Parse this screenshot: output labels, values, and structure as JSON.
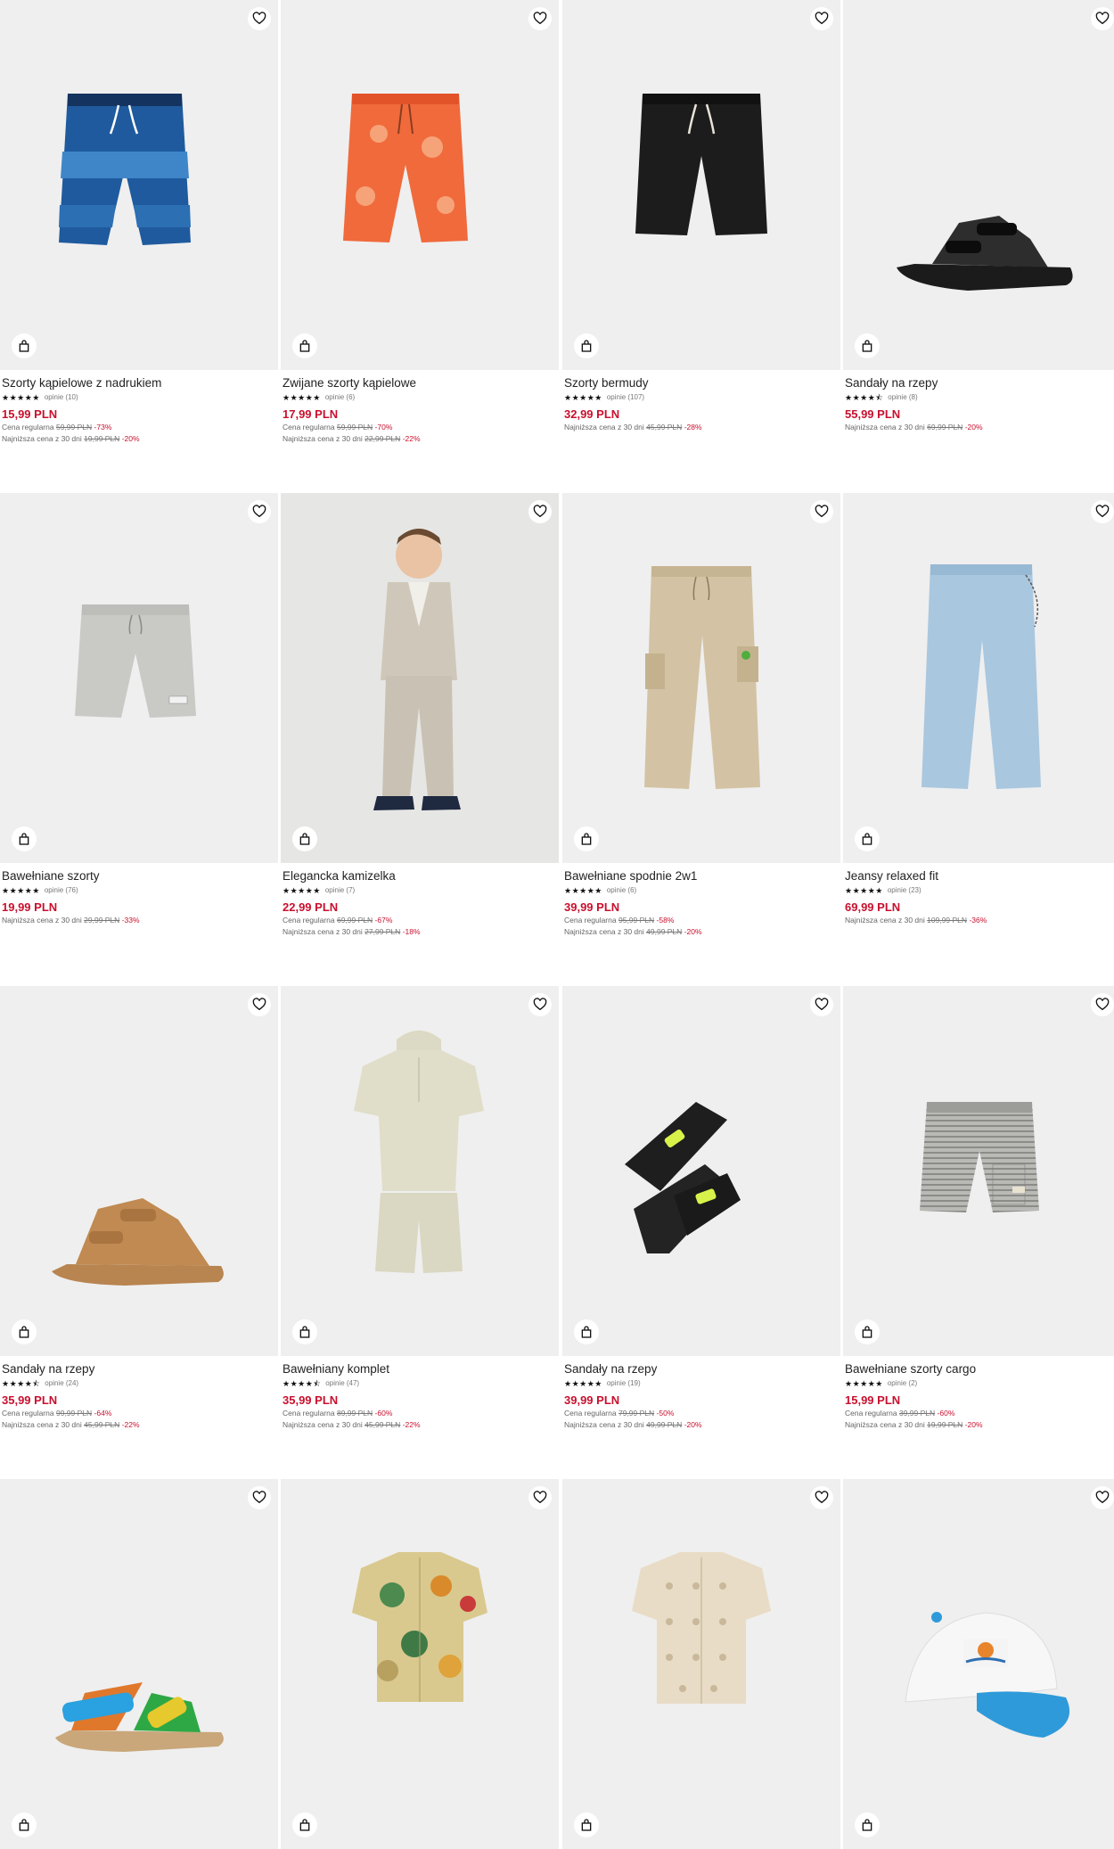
{
  "colors": {
    "sale": "#c8102e",
    "image_bg": "#efefef"
  },
  "icons": {
    "favorite": "heart-outline-icon",
    "cart": "shopping-bag-icon"
  },
  "products": [
    {
      "name": "Szorty kąpielowe z nadrukiem",
      "stars": "★★★★★",
      "reviews": "opinie (10)",
      "price": "15,99 PLN",
      "regular_label": "Cena regularna",
      "regular_old": "59,99 PLN",
      "regular_disc": "-73%",
      "lowest_label": "Najniższa cena z 30 dni",
      "lowest_old": "19,99 PLN",
      "lowest_disc": "-20%"
    },
    {
      "name": "Zwijane szorty kąpielowe",
      "stars": "★★★★★",
      "reviews": "opinie (6)",
      "price": "17,99 PLN",
      "regular_label": "Cena regularna",
      "regular_old": "59,99 PLN",
      "regular_disc": "-70%",
      "lowest_label": "Najniższa cena z 30 dni",
      "lowest_old": "22,99 PLN",
      "lowest_disc": "-22%"
    },
    {
      "name": "Szorty bermudy",
      "stars": "★★★★★",
      "reviews": "opinie (107)",
      "price": "32,99 PLN",
      "lowest_label": "Najniższa cena z 30 dni",
      "lowest_old": "45,99 PLN",
      "lowest_disc": "-28%"
    },
    {
      "name": "Sandały na rzepy",
      "stars": "★★★★⯪",
      "reviews": "opinie (8)",
      "price": "55,99 PLN",
      "lowest_label": "Najniższa cena z 30 dni",
      "lowest_old": "69,99 PLN",
      "lowest_disc": "-20%"
    },
    {
      "name": "Bawełniane szorty",
      "stars": "★★★★★",
      "reviews": "opinie (76)",
      "price": "19,99 PLN",
      "lowest_label": "Najniższa cena z 30 dni",
      "lowest_old": "29,99 PLN",
      "lowest_disc": "-33%"
    },
    {
      "name": "Elegancka kamizelka",
      "stars": "★★★★★",
      "reviews": "opinie (7)",
      "price": "22,99 PLN",
      "regular_label": "Cena regularna",
      "regular_old": "69,99 PLN",
      "regular_disc": "-67%",
      "lowest_label": "Najniższa cena z 30 dni",
      "lowest_old": "27,99 PLN",
      "lowest_disc": "-18%"
    },
    {
      "name": "Bawełniane spodnie 2w1",
      "stars": "★★★★★",
      "reviews": "opinie (6)",
      "price": "39,99 PLN",
      "regular_label": "Cena regularna",
      "regular_old": "95,99 PLN",
      "regular_disc": "-58%",
      "lowest_label": "Najniższa cena z 30 dni",
      "lowest_old": "49,99 PLN",
      "lowest_disc": "-20%"
    },
    {
      "name": "Jeansy relaxed fit",
      "stars": "★★★★★",
      "reviews": "opinie (23)",
      "price": "69,99 PLN",
      "lowest_label": "Najniższa cena z 30 dni",
      "lowest_old": "109,99 PLN",
      "lowest_disc": "-36%"
    },
    {
      "name": "Sandały na rzepy",
      "stars": "★★★★⯪",
      "reviews": "opinie (24)",
      "price": "35,99 PLN",
      "regular_label": "Cena regularna",
      "regular_old": "99,99 PLN",
      "regular_disc": "-64%",
      "lowest_label": "Najniższa cena z 30 dni",
      "lowest_old": "45,99 PLN",
      "lowest_disc": "-22%"
    },
    {
      "name": "Bawełniany komplet",
      "stars": "★★★★⯪",
      "reviews": "opinie (47)",
      "price": "35,99 PLN",
      "regular_label": "Cena regularna",
      "regular_old": "89,99 PLN",
      "regular_disc": "-60%",
      "lowest_label": "Najniższa cena z 30 dni",
      "lowest_old": "45,99 PLN",
      "lowest_disc": "-22%"
    },
    {
      "name": "Sandały na rzepy",
      "stars": "★★★★★",
      "reviews": "opinie (19)",
      "price": "39,99 PLN",
      "regular_label": "Cena regularna",
      "regular_old": "79,99 PLN",
      "regular_disc": "-50%",
      "lowest_label": "Najniższa cena z 30 dni",
      "lowest_old": "49,99 PLN",
      "lowest_disc": "-20%"
    },
    {
      "name": "Bawełniane szorty cargo",
      "stars": "★★★★★",
      "reviews": "opinie (2)",
      "price": "15,99 PLN",
      "regular_label": "Cena regularna",
      "regular_old": "39,99 PLN",
      "regular_disc": "-60%",
      "lowest_label": "Najniższa cena z 30 dni",
      "lowest_old": "19,99 PLN",
      "lowest_disc": "-20%"
    },
    {
      "name": "",
      "stars": "",
      "reviews": "",
      "price": ""
    },
    {
      "name": "",
      "stars": "",
      "reviews": "",
      "price": ""
    },
    {
      "name": "",
      "stars": "",
      "reviews": "",
      "price": ""
    },
    {
      "name": "",
      "stars": "",
      "reviews": "",
      "price": ""
    }
  ]
}
